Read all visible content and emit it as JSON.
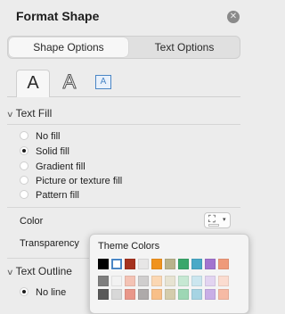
{
  "pane": {
    "title": "Format Shape"
  },
  "tabs": [
    {
      "label": "Shape Options",
      "active": true
    },
    {
      "label": "Text Options",
      "active": false
    }
  ],
  "icon_tabs": [
    {
      "icon": "text-fill-outline-icon",
      "glyph": "A",
      "selected": true
    },
    {
      "icon": "text-effects-icon",
      "glyph": "A",
      "selected": false
    },
    {
      "icon": "textbox-icon",
      "glyph": "A",
      "selected": false
    }
  ],
  "text_fill": {
    "header": "Text Fill",
    "options": [
      {
        "label": "No fill",
        "checked": false
      },
      {
        "label": "Solid fill",
        "checked": true
      },
      {
        "label": "Gradient fill",
        "checked": false
      },
      {
        "label": "Picture or texture fill",
        "checked": false
      },
      {
        "label": "Pattern fill",
        "checked": false
      }
    ],
    "color_label": "Color",
    "transparency_label": "Transparency"
  },
  "text_outline": {
    "header": "Text Outline",
    "options": [
      {
        "label": "No line",
        "checked": true
      }
    ]
  },
  "theme_colors": {
    "title": "Theme Colors",
    "rows": [
      [
        "#000000",
        "#ffffff",
        "#a5321f",
        "#e7e6e6",
        "#f0931e",
        "#b9b28b",
        "#3aa76b",
        "#49a9c7",
        "#a274cf",
        "#ef9a7a"
      ],
      [
        "#7f7f7f",
        "#f2f2f2",
        "#f4c3b5",
        "#d0cece",
        "#fbd7b3",
        "#e7e3d2",
        "#c6e8d3",
        "#cbe6ef",
        "#e2d4f1",
        "#fbdcd0"
      ],
      [
        "#595959",
        "#d8d8d8",
        "#e9978a",
        "#aeaaaa",
        "#f8bf88",
        "#d4ccac",
        "#9dd7b4",
        "#a6d4e3",
        "#c8aee6",
        "#f6baa4"
      ]
    ]
  },
  "colors": {
    "pane_bg": "#ececec",
    "accent": "#4a86c5",
    "selected_fill_color": "#ffffff"
  }
}
